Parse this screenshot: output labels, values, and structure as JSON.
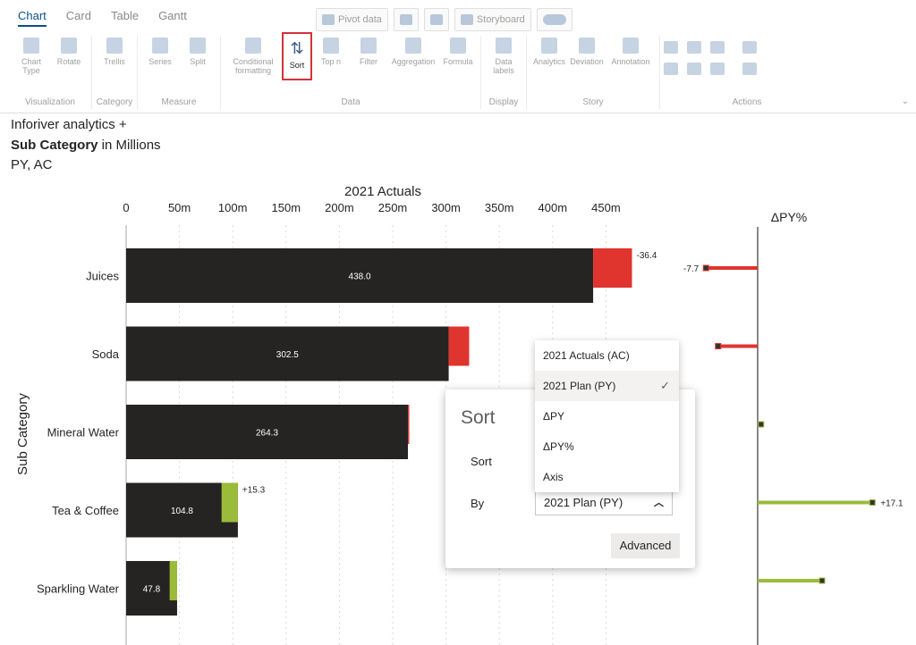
{
  "tabs": [
    "Chart",
    "Card",
    "Table",
    "Gantt"
  ],
  "active_tab": "Chart",
  "quick_buttons": [
    "Pivot data",
    "Storyboard"
  ],
  "ribbon_groups": [
    {
      "label": "Visualization",
      "buttons": [
        "Chart Type",
        "Rotate"
      ]
    },
    {
      "label": "Category",
      "buttons": [
        "Trellis"
      ]
    },
    {
      "label": "Measure",
      "buttons": [
        "Series",
        "Split"
      ]
    },
    {
      "label": "Data",
      "buttons": [
        "Conditional formatting",
        "Sort",
        "Top n",
        "Filter",
        "Aggregation",
        "Formula"
      ]
    },
    {
      "label": "Display",
      "buttons": [
        "Data labels"
      ]
    },
    {
      "label": "Story",
      "buttons": [
        "Analytics",
        "Deviation",
        "Annotation"
      ]
    },
    {
      "label": "Actions",
      "buttons": []
    }
  ],
  "captions": {
    "line1": "Inforiver analytics +",
    "line2_bold": "Sub Category",
    "line2_rest": " in Millions",
    "line3": "PY, AC"
  },
  "chart_data": {
    "type": "bar",
    "orientation": "horizontal",
    "title": "2021 Actuals",
    "ylabel": "Sub Category",
    "categories": [
      "Juices",
      "Soda",
      "Mineral Water",
      "Tea & Coffee",
      "Sparkling Water"
    ],
    "series": [
      {
        "name": "AC",
        "values": [
          438.0,
          302.5,
          264.3,
          104.8,
          47.8
        ]
      },
      {
        "name": "PY",
        "values": [
          474.4,
          321.7,
          265.5,
          89.5,
          40.8
        ]
      }
    ],
    "value_labels": [
      "438.0",
      "302.5",
      "264.3",
      "104.8",
      "47.8"
    ],
    "delta_labels": [
      "-36.4",
      "",
      "",
      "+15.3",
      ""
    ],
    "x_ticks": [
      0,
      50,
      100,
      150,
      200,
      250,
      300,
      350,
      400,
      450
    ],
    "x_tick_labels": [
      "0",
      "50m",
      "100m",
      "150m",
      "200m",
      "250m",
      "300m",
      "350m",
      "400m",
      "450m"
    ],
    "xlim": [
      0,
      480
    ],
    "delta_pct_title": "ΔPY%",
    "delta_pct_values": [
      -7.7,
      -5.9,
      0.5,
      17.1,
      9.6
    ],
    "delta_pct_labels": [
      "-7.7",
      "",
      "",
      "+17.1",
      ""
    ],
    "colors": {
      "bar": "#252423",
      "negative": "#e0342f",
      "positive": "#9bbb3b",
      "axis": "#888888"
    }
  },
  "sort_panel": {
    "title": "Sort",
    "sort_label": "Sort",
    "by_label": "By",
    "by_value": "2021 Plan (PY)",
    "advanced_label": "Advanced",
    "options": [
      "2021 Actuals (AC)",
      "2021 Plan (PY)",
      "ΔPY",
      "ΔPY%",
      "Axis"
    ],
    "selected_option": "2021 Plan (PY)"
  }
}
